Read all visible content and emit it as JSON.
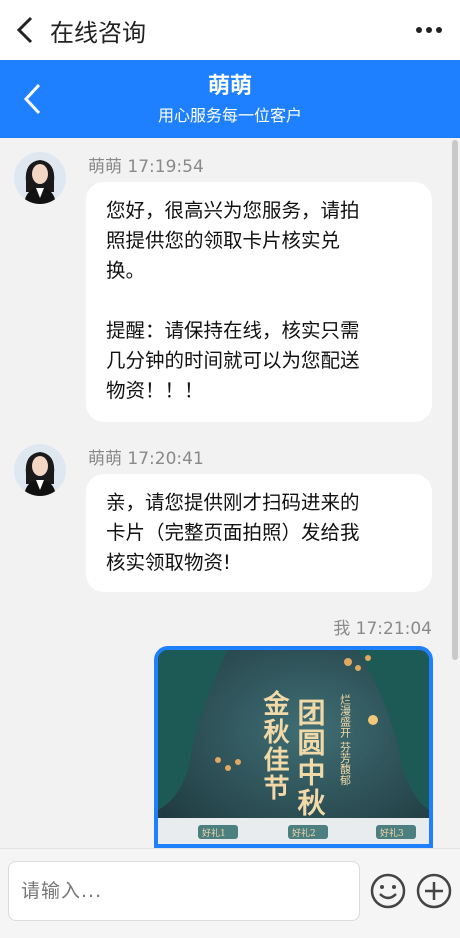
{
  "topbar": {
    "title": "在线咨询"
  },
  "header": {
    "name": "萌萌",
    "slogan": "用心服务每一位客户"
  },
  "messages": [
    {
      "sender": "萌萌",
      "time": "萌萌 17:19:54",
      "text": "您好，很高兴为您服务，请拍\n照提供您的领取卡片核实兑\n换。\n\n提醒：请保持在线，核实只需\n几分钟的时间就可以为您配送\n物资！！！"
    },
    {
      "sender": "萌萌",
      "time": "萌萌 17:20:41",
      "text": "亲，请您提供刚才扫码进来的\n卡片（完整页面拍照）发给我\n核实领取物资!"
    },
    {
      "sender": "我",
      "time": "我 17:21:04",
      "photo": {
        "line1": "金秋佳节",
        "line2": "团圆中秋",
        "line3": "烂漫盛开 芬芳馥郁",
        "gifts": [
          "好礼1",
          "好礼2",
          "好礼3"
        ]
      }
    }
  ],
  "input": {
    "placeholder": "请输入..."
  },
  "colors": {
    "brand": "#1e80ff",
    "bubble": "#ffffff",
    "background": "#f2f2f2"
  },
  "icons": {
    "back": "back-arrow-icon",
    "more": "more-dots-icon",
    "emoji": "smiley-icon",
    "add": "plus-circle-icon"
  }
}
